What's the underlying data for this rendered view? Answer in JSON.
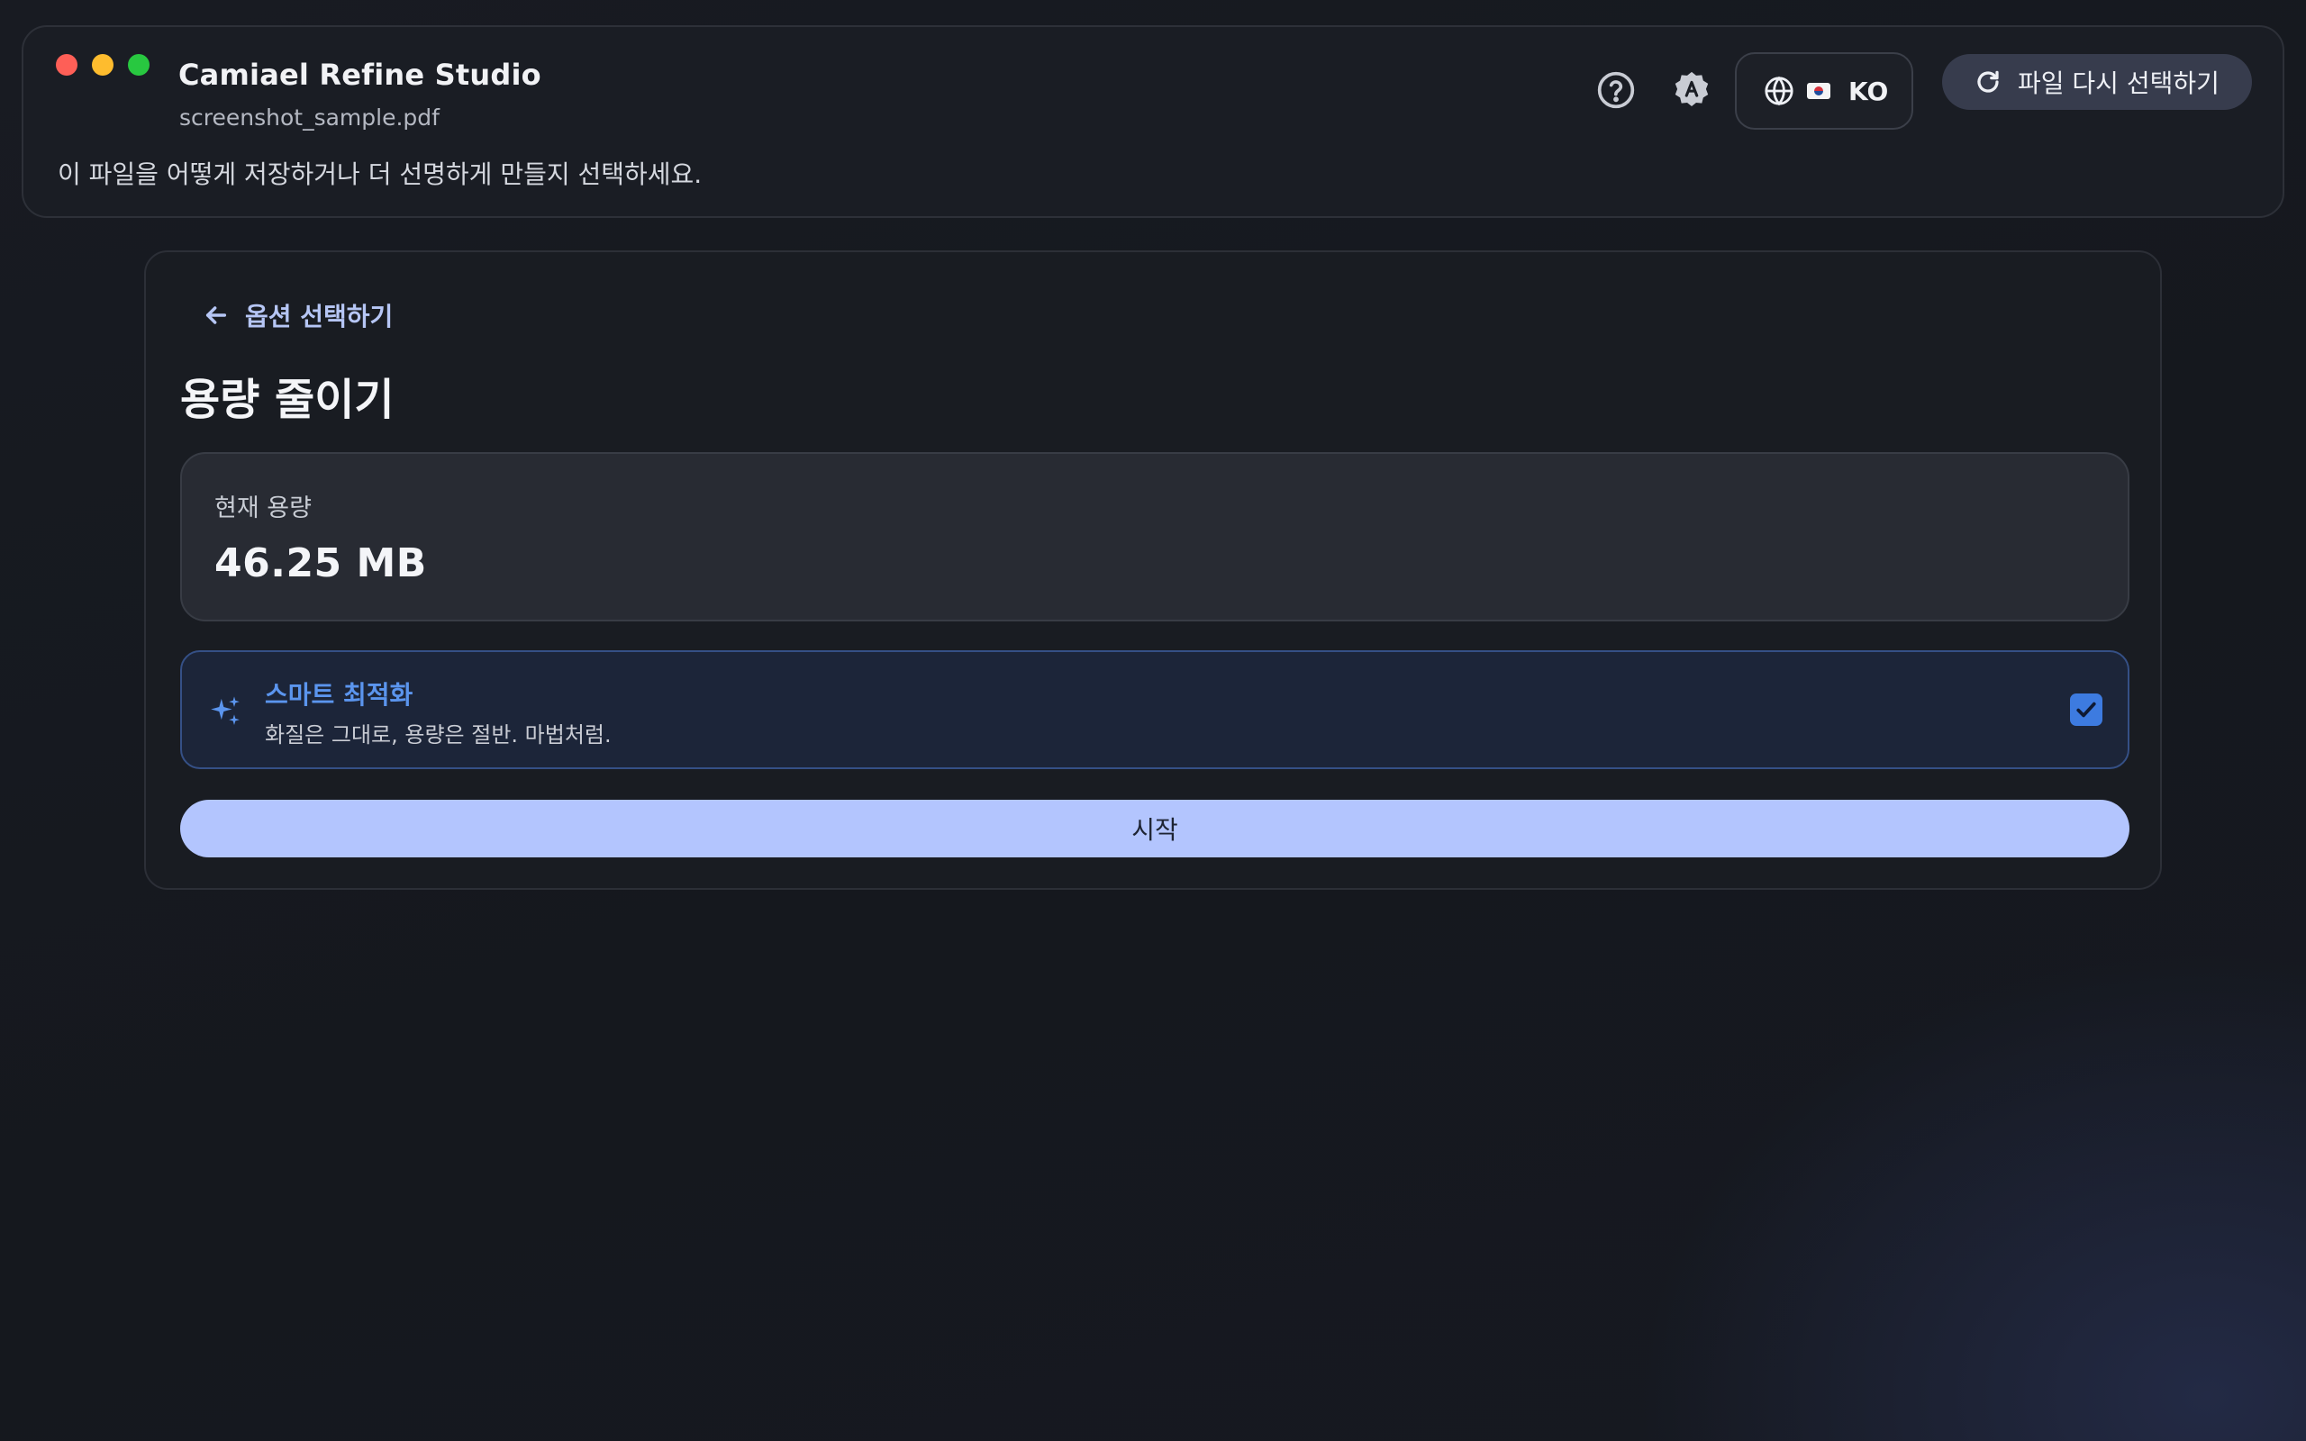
{
  "window": {
    "title": "Camiael Refine Studio",
    "file_name": "screenshot_sample.pdf",
    "instruction": "이 파일을 어떻게 저장하거나 더 선명하게 만들지 선택하세요."
  },
  "toolbar": {
    "help_icon": "help-circle-icon",
    "theme_icon": "auto-theme-icon",
    "language_code": "KO",
    "reselect_label": "파일 다시 선택하기"
  },
  "panel": {
    "back_label": "옵션 선택하기",
    "title": "용량 줄이기",
    "current_size_label": "현재 용량",
    "current_size_value": "46.25 MB",
    "option": {
      "title": "스마트 최적화",
      "description": "화질은 그대로, 용량은 절반. 마법처럼.",
      "checked": true
    },
    "start_label": "시작"
  },
  "colors": {
    "accent": "#5b95ee",
    "start_button": "#b3c5fe",
    "checkbox": "#3d7be0"
  }
}
